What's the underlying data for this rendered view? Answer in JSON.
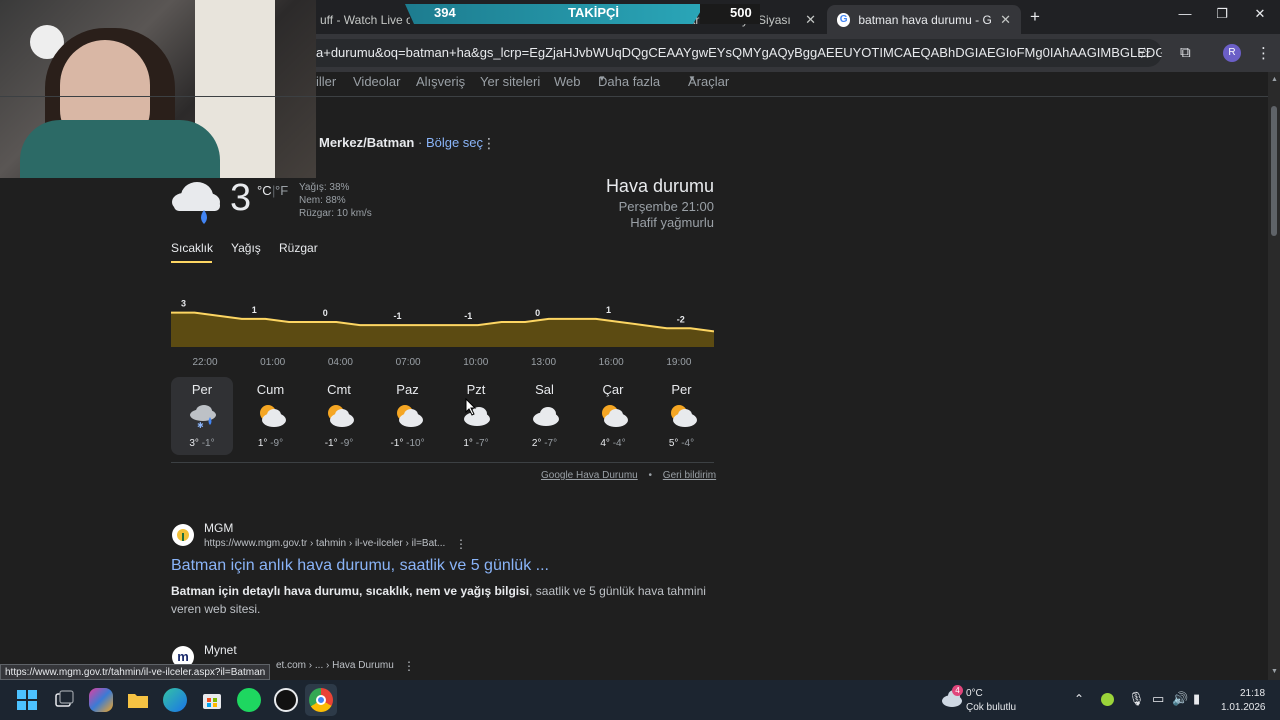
{
  "overlay": {
    "followers_current": "394",
    "followers_label": "TAKİPÇİ",
    "followers_goal": "500"
  },
  "tabs": [
    {
      "title": "uff - Watch Live o"
    },
    {
      "title": "Haritası - ...ye Siyası"
    },
    {
      "title": "batman hava durumu - Google"
    }
  ],
  "address": {
    "url": "a+durumu&oq=batman+ha&gs_lcrp=EgZjaHJvbWUqDQgCEAAYgwEYsQMYgAQyBggAEEUYOTIMCAEQABhDGIAEGIoFMg0IAhAAGIMBGLEDGIAEMgwIAxAA..."
  },
  "profile_initial": "R",
  "search_nav": [
    "iller",
    "Videolar",
    "Alışveriş",
    "Yer siteleri",
    "Web",
    "Daha fazla",
    "Araçlar"
  ],
  "weather": {
    "location": "Merkez/Batman",
    "location_separator": " · ",
    "select_region": "Bölge seç",
    "temp": "3",
    "unit_c": "°C",
    "unit_f": "°F",
    "precip": "Yağış: 38%",
    "humidity": "Nem: 88%",
    "wind": "Rüzgar: 10 km/s",
    "title": "Hava durumu",
    "time": "Perşembe 21:00",
    "condition": "Hafif yağmurlu",
    "tabs": [
      "Sıcaklık",
      "Yağış",
      "Rüzgar"
    ],
    "hours": [
      "22:00",
      "01:00",
      "04:00",
      "07:00",
      "10:00",
      "13:00",
      "16:00",
      "19:00"
    ],
    "days": [
      {
        "name": "Per",
        "hi": "3°",
        "lo": "-1°",
        "icon": "snow-rain-icon"
      },
      {
        "name": "Cum",
        "hi": "1°",
        "lo": "-9°",
        "icon": "partly-sunny-icon"
      },
      {
        "name": "Cmt",
        "hi": "-1°",
        "lo": "-9°",
        "icon": "partly-sunny-icon"
      },
      {
        "name": "Paz",
        "hi": "-1°",
        "lo": "-10°",
        "icon": "partly-sunny-icon"
      },
      {
        "name": "Pzt",
        "hi": "1°",
        "lo": "-7°",
        "icon": "cloudy-icon"
      },
      {
        "name": "Sal",
        "hi": "2°",
        "lo": "-7°",
        "icon": "cloudy-icon"
      },
      {
        "name": "Çar",
        "hi": "4°",
        "lo": "-4°",
        "icon": "partly-sunny-icon"
      },
      {
        "name": "Per",
        "hi": "5°",
        "lo": "-4°",
        "icon": "partly-sunny-icon"
      }
    ],
    "footer_source": "Google Hava Durumu",
    "footer_dot": "•",
    "footer_feedback": "Geri bildirim"
  },
  "chart_data": {
    "type": "area",
    "x": [
      "22:00",
      "23:00",
      "00:00",
      "01:00",
      "02:00",
      "03:00",
      "04:00",
      "05:00",
      "06:00",
      "07:00",
      "08:00",
      "09:00",
      "10:00",
      "11:00",
      "12:00",
      "13:00",
      "14:00",
      "15:00",
      "16:00",
      "17:00",
      "18:00",
      "19:00",
      "20:00",
      "21:00"
    ],
    "values": [
      3,
      3,
      2,
      1,
      1,
      0,
      0,
      0,
      -1,
      -1,
      -1,
      -1,
      -1,
      -1,
      0,
      0,
      1,
      1,
      1,
      0,
      -1,
      -2,
      -2,
      -3
    ],
    "labels": [
      "3",
      "1",
      "0",
      "-1",
      "-1",
      "0",
      "1",
      "-2"
    ],
    "series_color": "#fdd663",
    "fill_color": "#5c4b12",
    "grid": false
  },
  "results": [
    {
      "site": "MGM",
      "url": "https://www.mgm.gov.tr › tahmin › il-ve-ilceler › il=Bat...",
      "title": "Batman için anlık hava durumu, saatlik ve 5 günlük ...",
      "snippet_bold": "Batman için detaylı hava durumu, sıcaklık, nem ve yağış bilgisi",
      "snippet_rest": ", saatlik ve 5 günlük hava tahmini veren web sitesi."
    },
    {
      "site": "Mynet",
      "url": "et.com › ... › Hava Durumu"
    }
  ],
  "status_url": "https://www.mgm.gov.tr/tahmin/il-ve-ilceler.aspx?il=Batman",
  "taskbar": {
    "weather_badge": "4",
    "weather_temp": "0°C",
    "weather_desc": "Çok bulutlu",
    "time": "21:18",
    "date": "1.01.2026"
  }
}
